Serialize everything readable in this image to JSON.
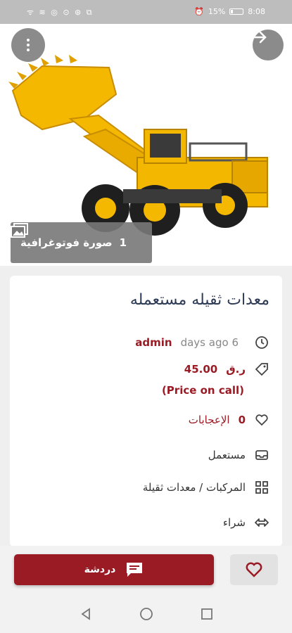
{
  "status_bar": {
    "left_icons": "ᯤ ≋ ◎ ⊙ ⊛ ⧉",
    "battery": "15%",
    "time": "8:08"
  },
  "hero": {
    "photo_count": "1",
    "photo_label": "صورة فوتوغرافية"
  },
  "listing": {
    "title": "معدات ثقيله مستعمله",
    "date_ago": "6 days ago",
    "author": "admin",
    "price": "45.00",
    "currency": "ر.ق",
    "price_note": "(Price on call)",
    "likes_count": "0",
    "likes_label": "الإعجابات",
    "condition": "مستعمل",
    "category": "المركبات / معدات ثقيلة",
    "ad_type": "شراء"
  },
  "actions": {
    "chat_label": "دردشة"
  },
  "colors": {
    "accent": "#9b1b25",
    "title": "#2d3a55"
  }
}
